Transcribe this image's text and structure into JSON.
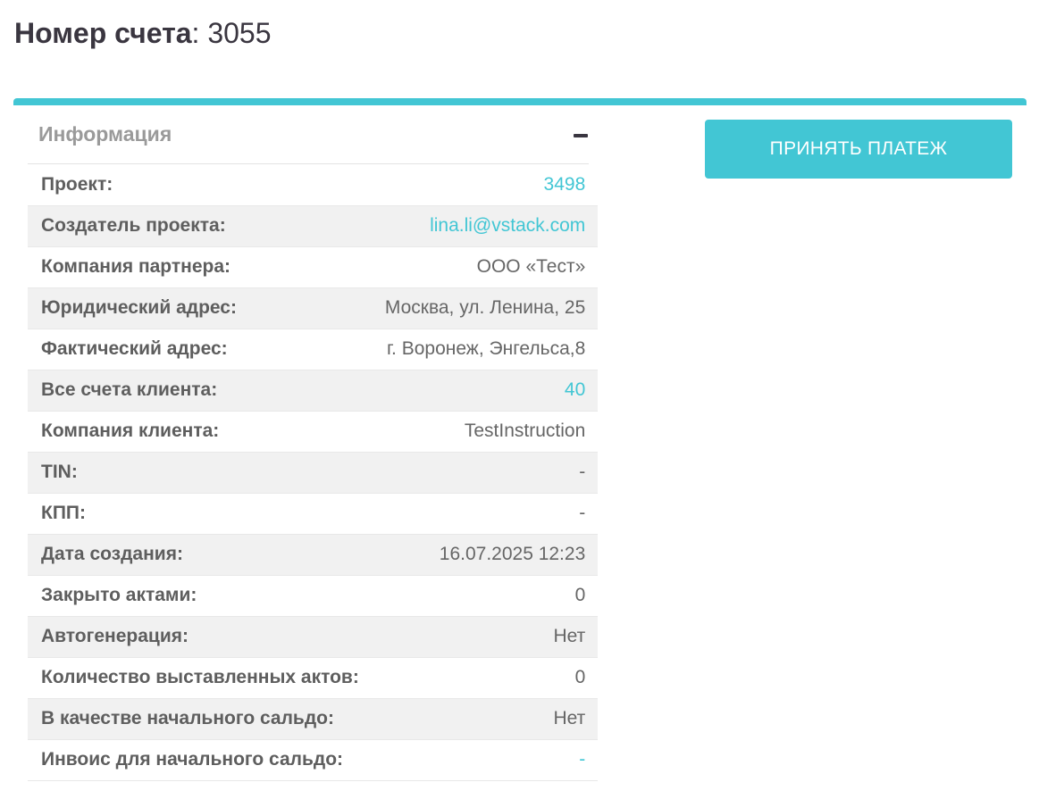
{
  "header": {
    "title_label": "Номер счета",
    "title_separator": ": ",
    "account_number": "3055"
  },
  "info": {
    "title": "Информация",
    "collapse_icon": "minus-icon",
    "rows": [
      {
        "label": "Проект:",
        "value": "3498",
        "link": true
      },
      {
        "label": "Создатель проекта:",
        "value": "lina.li@vstack.com",
        "link": true
      },
      {
        "label": "Компания партнера:",
        "value": "ООО «Тест»",
        "link": false
      },
      {
        "label": "Юридический адрес:",
        "value": "Москва, ул. Ленина, 25",
        "link": false
      },
      {
        "label": "Фактический адрес:",
        "value": "г. Воронеж, Энгельса,8",
        "link": false
      },
      {
        "label": "Все счета клиента:",
        "value": "40",
        "link": true
      },
      {
        "label": "Компания клиента:",
        "value": "TestInstruction",
        "link": false
      },
      {
        "label": "TIN:",
        "value": "-",
        "link": false
      },
      {
        "label": "КПП:",
        "value": "-",
        "link": false
      },
      {
        "label": "Дата создания:",
        "value": "16.07.2025 12:23",
        "link": false
      },
      {
        "label": "Закрыто актами:",
        "value": "0",
        "link": false
      },
      {
        "label": "Автогенерация:",
        "value": "Нет",
        "link": false
      },
      {
        "label": "Количество выставленных актов:",
        "value": "0",
        "link": false
      },
      {
        "label": "В качестве начального сальдо:",
        "value": "Нет",
        "link": false
      },
      {
        "label": "Инвоис для начального сальдо:",
        "value": "-",
        "link": true
      }
    ]
  },
  "actions": {
    "accept_payment_label": "ПРИНЯТЬ ПЛАТЕЖ"
  },
  "colors": {
    "accent": "#42c6d4",
    "title_text": "#3a3640",
    "row_stripe": "#f1f1f1"
  }
}
